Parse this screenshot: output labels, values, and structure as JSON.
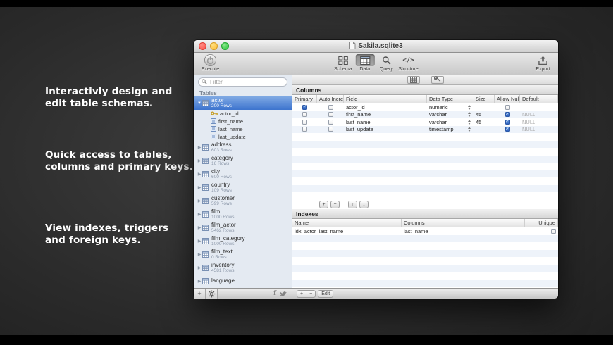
{
  "captions": [
    {
      "text": "Interactivly design and\nedit table schemas."
    },
    {
      "text": "Quick access to tables,\ncolumns and primary keys."
    },
    {
      "text": "View indexes, triggers\nand foreign keys."
    }
  ],
  "window": {
    "title": "Sakila.sqlite3",
    "toolbar": {
      "execute": "Execute",
      "export": "Export",
      "items": [
        {
          "label": "Schema",
          "icon": "schema-icon",
          "active": false
        },
        {
          "label": "Data",
          "icon": "data-icon",
          "active": true
        },
        {
          "label": "Query",
          "icon": "query-icon",
          "active": false
        },
        {
          "label": "Structure",
          "icon": "structure-icon",
          "active": false
        }
      ]
    },
    "sidebar": {
      "filter_placeholder": "Filter",
      "section_label": "Tables",
      "tables": [
        {
          "name": "actor",
          "rows": "200 Rows",
          "selected": true,
          "expanded": true,
          "columns": [
            {
              "name": "actor_id",
              "icon": "key-icon"
            },
            {
              "name": "first_name",
              "icon": "column-icon"
            },
            {
              "name": "last_name",
              "icon": "column-icon"
            },
            {
              "name": "last_update",
              "icon": "column-icon"
            }
          ]
        },
        {
          "name": "address",
          "rows": "603 Rows"
        },
        {
          "name": "category",
          "rows": "16 Rows"
        },
        {
          "name": "city",
          "rows": "600 Rows"
        },
        {
          "name": "country",
          "rows": "109 Rows"
        },
        {
          "name": "customer",
          "rows": "599 Rows"
        },
        {
          "name": "film",
          "rows": "1000 Rows"
        },
        {
          "name": "film_actor",
          "rows": "5462 Rows"
        },
        {
          "name": "film_category",
          "rows": "1000 Rows"
        },
        {
          "name": "film_text",
          "rows": "0 Rows"
        },
        {
          "name": "inventory",
          "rows": "4581 Rows"
        },
        {
          "name": "language",
          "rows": ""
        }
      ],
      "footer_buttons": [
        {
          "label": "+",
          "icon": "plus-icon"
        },
        {
          "label": "",
          "icon": "gear-icon"
        }
      ],
      "social": [
        {
          "label": "f",
          "icon": "facebook-icon"
        },
        {
          "label": "",
          "icon": "twitter-icon"
        }
      ]
    },
    "columns_panel": {
      "title": "Columns",
      "headers": [
        "Primary",
        "Auto Incre...",
        "Field",
        "Data Type",
        "Size",
        "Allow Null",
        "Default"
      ],
      "rows": [
        {
          "primary": true,
          "auto_increment": false,
          "field": "actor_id",
          "data_type": "numeric",
          "size": "",
          "allow_null": false,
          "default": ""
        },
        {
          "primary": false,
          "auto_increment": false,
          "field": "first_name",
          "data_type": "varchar",
          "size": "45",
          "allow_null": true,
          "default": "NULL"
        },
        {
          "primary": false,
          "auto_increment": false,
          "field": "last_name",
          "data_type": "varchar",
          "size": "45",
          "allow_null": true,
          "default": "NULL"
        },
        {
          "primary": false,
          "auto_increment": false,
          "field": "last_update",
          "data_type": "timestamp",
          "size": "",
          "allow_null": true,
          "default": "NULL"
        }
      ],
      "actions": [
        "+",
        "−",
        "↑",
        "↓"
      ]
    },
    "indexes_panel": {
      "title": "Indexes",
      "headers": [
        "Name",
        "Columns",
        "Unique"
      ],
      "rows": [
        {
          "name": "idx_actor_last_name",
          "columns": "last_name",
          "unique": false
        }
      ]
    },
    "footer": {
      "add": "+",
      "remove": "−",
      "edit": "Edit"
    }
  }
}
